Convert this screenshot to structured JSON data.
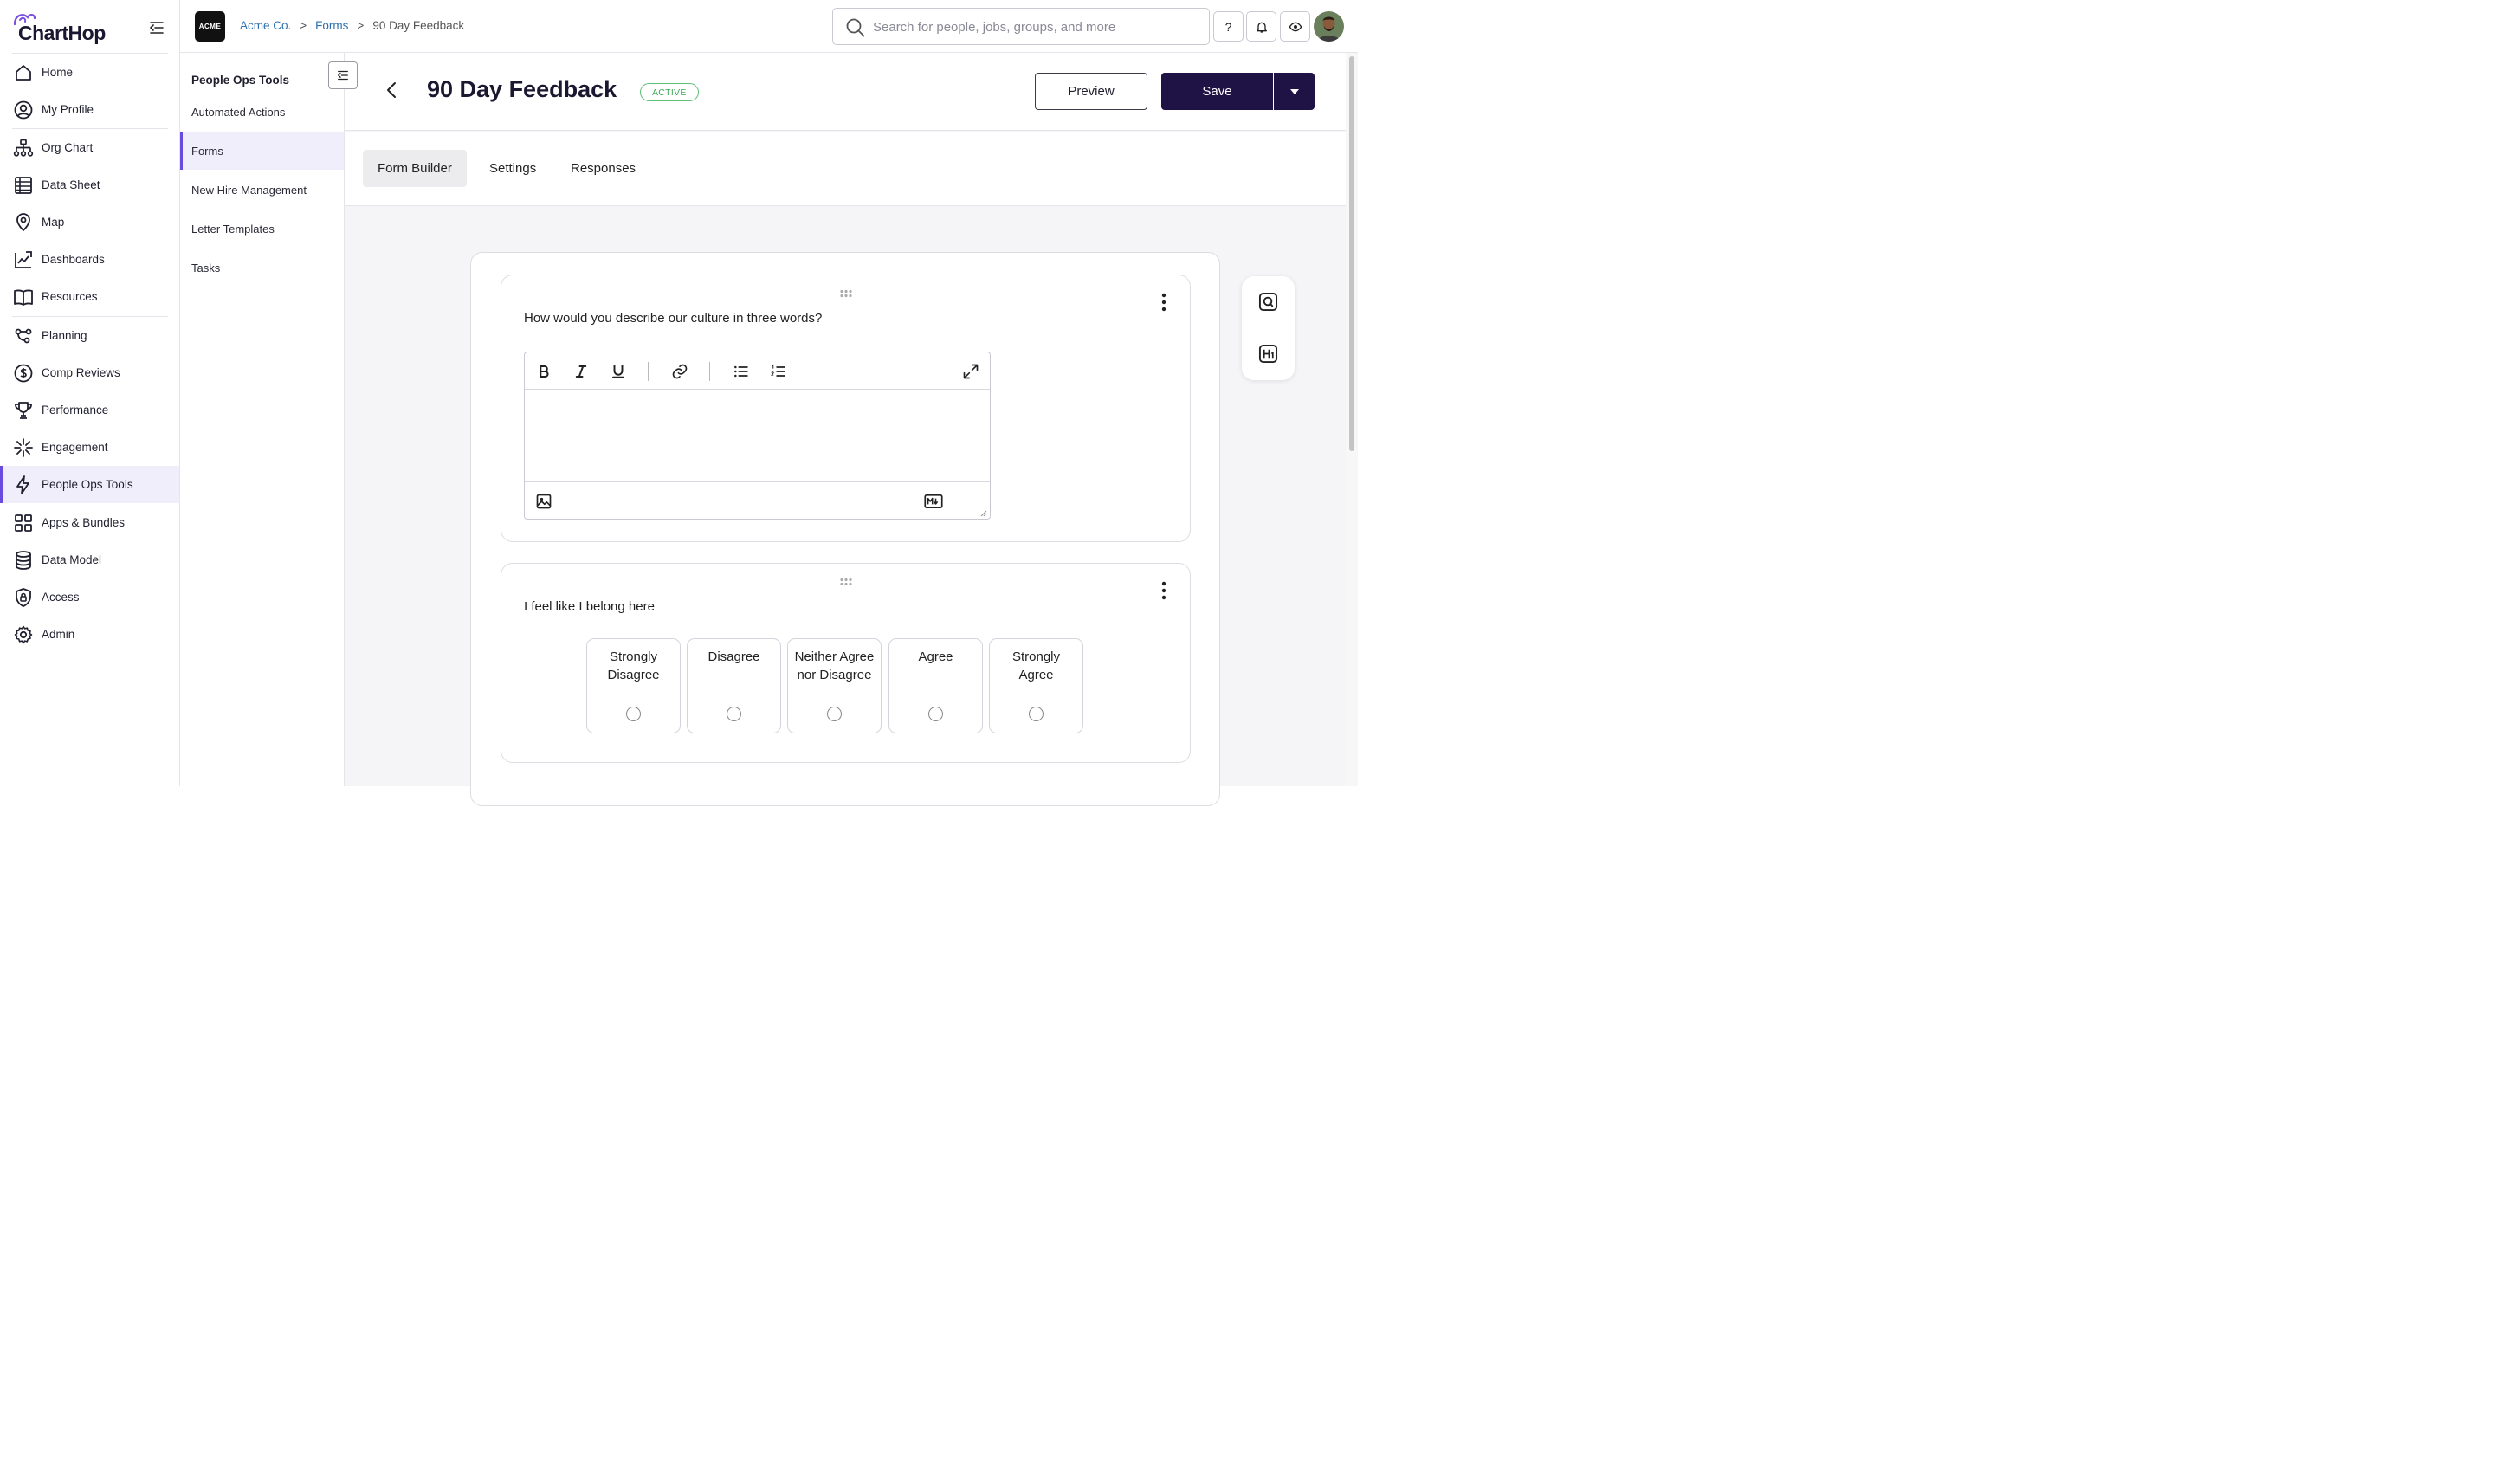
{
  "app": {
    "name": "ChartHop"
  },
  "nav": {
    "items": [
      {
        "label": "Home",
        "icon": "home-icon"
      },
      {
        "label": "My Profile",
        "icon": "user-circle-icon"
      },
      {
        "label": "Org Chart",
        "icon": "org-chart-icon"
      },
      {
        "label": "Data Sheet",
        "icon": "spreadsheet-icon"
      },
      {
        "label": "Map",
        "icon": "map-pin-icon"
      },
      {
        "label": "Dashboards",
        "icon": "dashboard-icon"
      },
      {
        "label": "Resources",
        "icon": "book-icon"
      },
      {
        "label": "Planning",
        "icon": "planning-icon"
      },
      {
        "label": "Comp Reviews",
        "icon": "dollar-circle-icon"
      },
      {
        "label": "Performance",
        "icon": "trophy-icon"
      },
      {
        "label": "Engagement",
        "icon": "sparkle-icon"
      },
      {
        "label": "People Ops Tools",
        "icon": "lightning-icon"
      },
      {
        "label": "Apps & Bundles",
        "icon": "apps-grid-icon"
      },
      {
        "label": "Data Model",
        "icon": "database-icon"
      },
      {
        "label": "Access",
        "icon": "shield-lock-icon"
      },
      {
        "label": "Admin",
        "icon": "gear-icon"
      }
    ],
    "active": "People Ops Tools"
  },
  "header": {
    "company_logo": "ACME",
    "breadcrumb": [
      "Acme Co.",
      "Forms",
      "90 Day Feedback"
    ],
    "breadcrumb_sep": ">",
    "search_placeholder": "Search for people, jobs, groups, and more",
    "help_label": "?"
  },
  "subnav": {
    "title": "People Ops Tools",
    "items": [
      "Automated Actions",
      "Forms",
      "New Hire Management",
      "Letter Templates",
      "Tasks"
    ],
    "active": "Forms"
  },
  "page": {
    "title": "90 Day Feedback",
    "status": "ACTIVE",
    "preview_label": "Preview",
    "save_label": "Save",
    "tabs": [
      "Form Builder",
      "Settings",
      "Responses"
    ],
    "active_tab": "Form Builder"
  },
  "questions": [
    {
      "text": "How would you describe our culture in three words?",
      "type": "rich-text",
      "toolbar": [
        "bold-icon",
        "italic-icon",
        "underline-icon",
        "link-icon",
        "bullet-list-icon",
        "numbered-list-icon",
        "expand-icon"
      ],
      "footer": [
        "image-icon",
        "markdown-icon"
      ]
    },
    {
      "text": "I feel like I belong here",
      "type": "likert",
      "options": [
        "Strongly Disagree",
        "Disagree",
        "Neither Agree nor Disagree",
        "Agree",
        "Strongly Agree"
      ]
    }
  ],
  "side_tools": [
    "add-question-icon",
    "add-heading-icon"
  ],
  "colors": {
    "accent": "#6a4be0",
    "brand_dark": "#1f1346",
    "active_badge": "#3fa95a",
    "link": "#2b6fb0"
  }
}
